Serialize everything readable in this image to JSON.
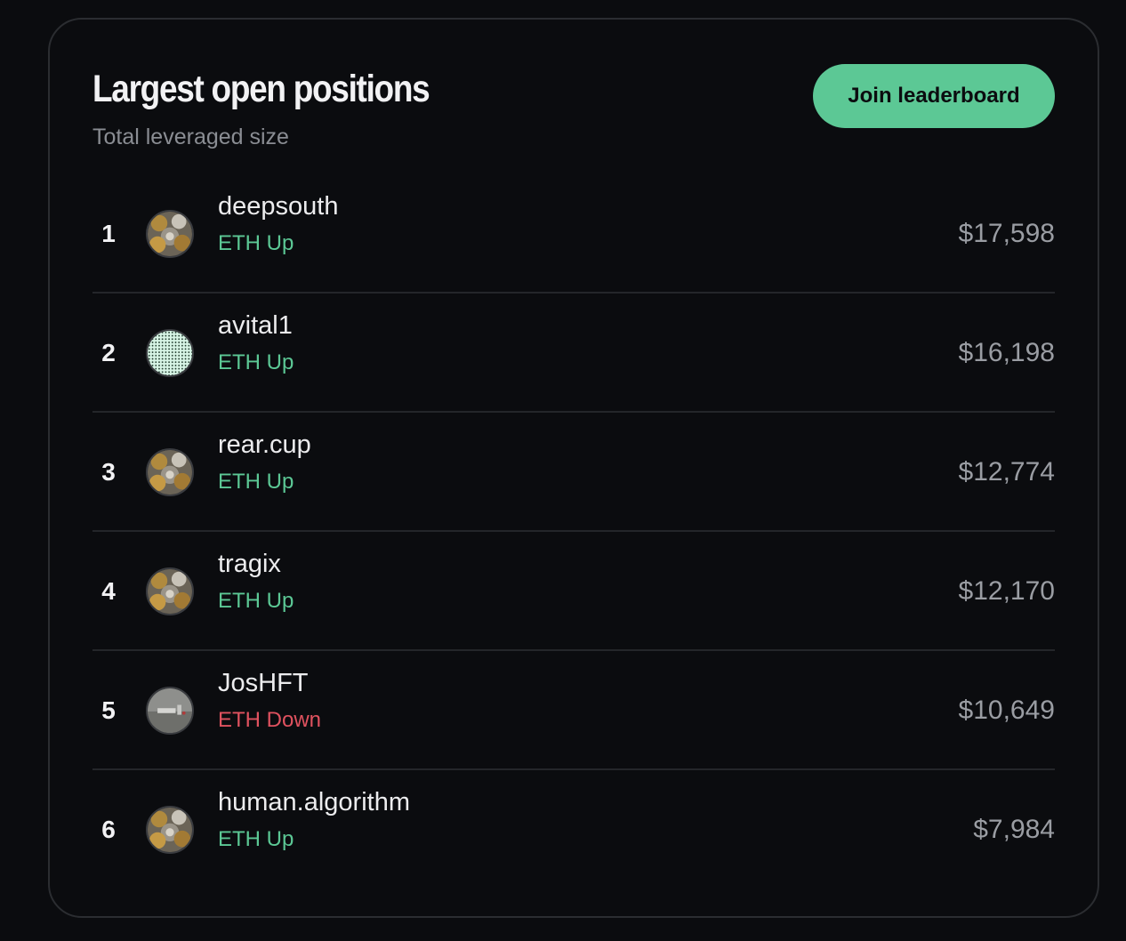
{
  "header": {
    "title": "Largest open positions",
    "subtitle": "Total leveraged size",
    "join_label": "Join leaderboard"
  },
  "colors": {
    "accent": "#5cc895",
    "up": "#5cc895",
    "down": "#e0525f",
    "background": "#0b0c0f"
  },
  "rows": [
    {
      "rank": "1",
      "name": "deepsouth",
      "direction": "ETH Up",
      "trend": "up",
      "amount": "$17,598",
      "avatar": "coins-avatar-icon"
    },
    {
      "rank": "2",
      "name": "avital1",
      "direction": "ETH Up",
      "trend": "up",
      "amount": "$16,198",
      "avatar": "dotted-avatar-icon"
    },
    {
      "rank": "3",
      "name": "rear.cup",
      "direction": "ETH Up",
      "trend": "up",
      "amount": "$12,774",
      "avatar": "coins-avatar-icon"
    },
    {
      "rank": "4",
      "name": "tragix",
      "direction": "ETH Up",
      "trend": "up",
      "amount": "$12,170",
      "avatar": "coins-avatar-icon"
    },
    {
      "rank": "5",
      "name": "JosHFT",
      "direction": "ETH Down",
      "trend": "down",
      "amount": "$10,649",
      "avatar": "photo-avatar-icon"
    },
    {
      "rank": "6",
      "name": "human.algorithm",
      "direction": "ETH Up",
      "trend": "up",
      "amount": "$7,984",
      "avatar": "coins-avatar-icon"
    }
  ]
}
